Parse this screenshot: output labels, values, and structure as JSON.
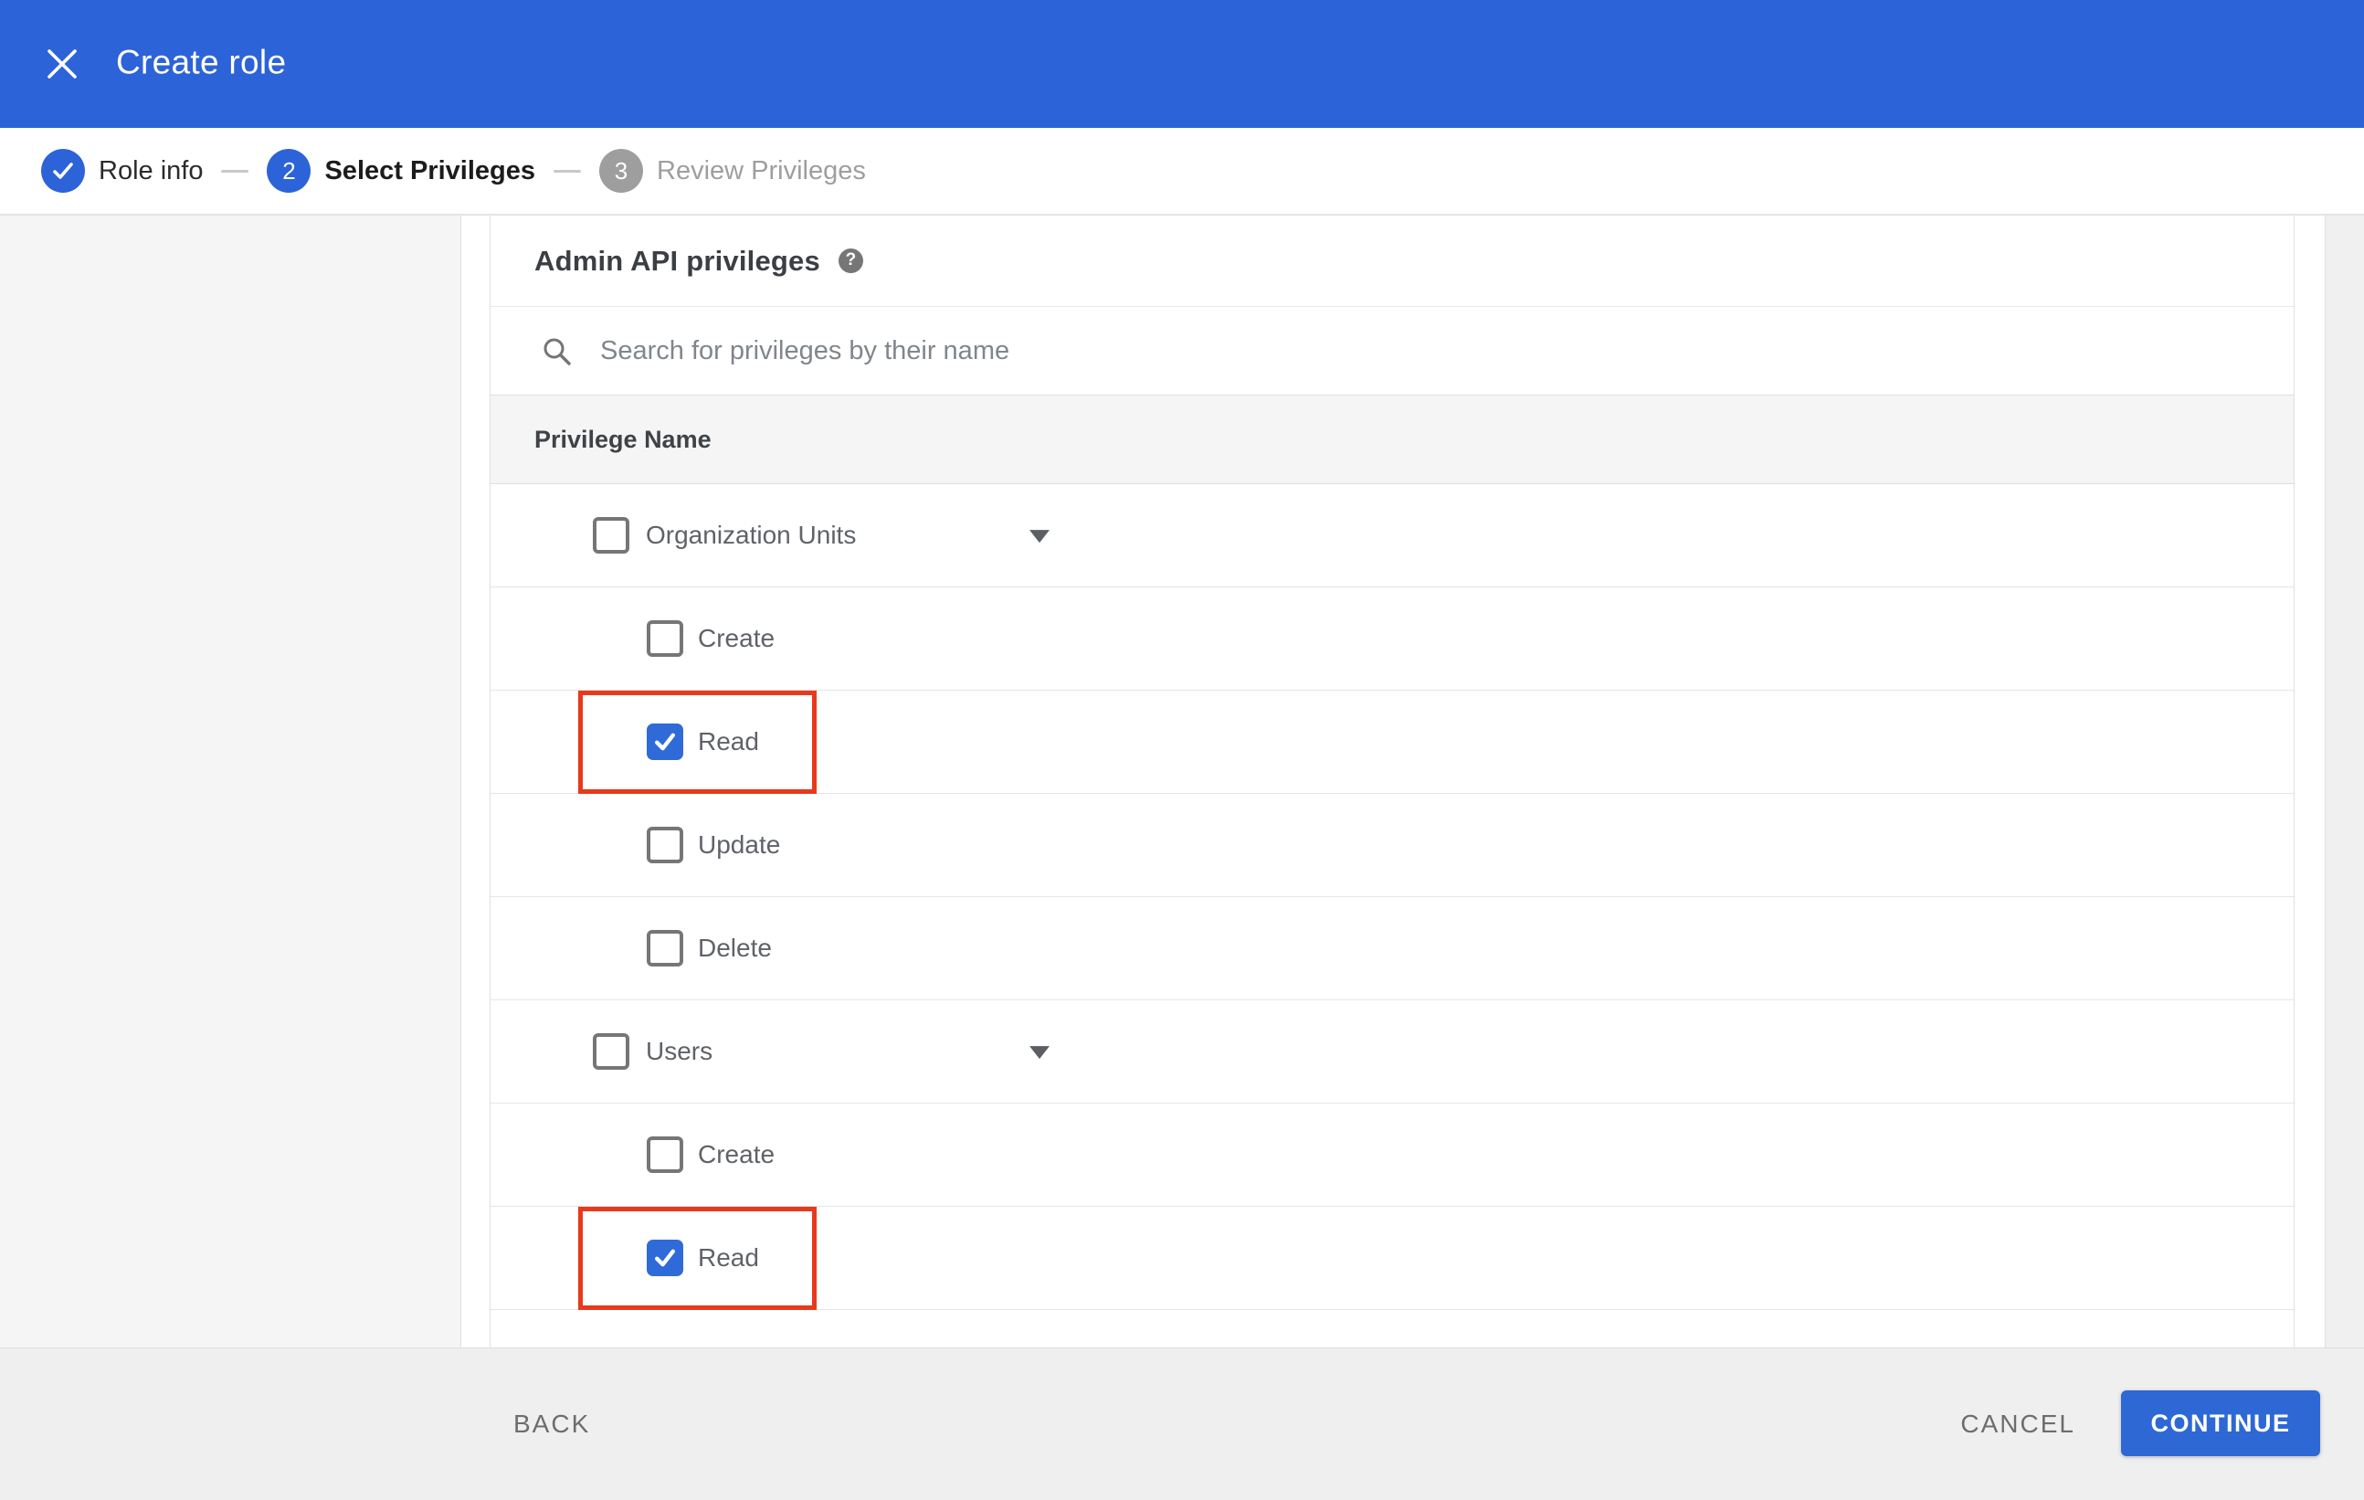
{
  "colors": {
    "app_bar_blue": "#2d63d8",
    "primary_blue": "#2e68d5",
    "checkbox_blue": "#2f6bd8",
    "highlight_red": "#e8391c",
    "step_inactive_gray": "#9e9e9e"
  },
  "icons": {
    "close": "✕",
    "search": "magnifier",
    "help": "?",
    "collapse": "▼",
    "check": "✓"
  },
  "header": {
    "title": "Create role"
  },
  "stepper": {
    "steps": [
      {
        "label": "Role info",
        "indicator": "✓",
        "status": "complete"
      },
      {
        "label": "Select Privileges",
        "indicator": "2",
        "status": "current"
      },
      {
        "label": "Review Privileges",
        "indicator": "3",
        "status": "upcoming"
      }
    ]
  },
  "content": {
    "section_title": "Admin API privileges",
    "help_glyph": "?",
    "search_placeholder": "Search for privileges by their name",
    "table_header": "Privilege Name",
    "rows": [
      {
        "type": "parent",
        "label": "Organization Units",
        "checked": false,
        "highlighted": false
      },
      {
        "type": "child",
        "label": "Create",
        "checked": false,
        "highlighted": false
      },
      {
        "type": "child",
        "label": "Read",
        "checked": true,
        "highlighted": true
      },
      {
        "type": "child",
        "label": "Update",
        "checked": false,
        "highlighted": false
      },
      {
        "type": "child",
        "label": "Delete",
        "checked": false,
        "highlighted": false
      },
      {
        "type": "parent",
        "label": "Users",
        "checked": false,
        "highlighted": false
      },
      {
        "type": "child",
        "label": "Create",
        "checked": false,
        "highlighted": false
      },
      {
        "type": "child",
        "label": "Read",
        "checked": true,
        "highlighted": true
      }
    ]
  },
  "footer": {
    "back_label": "BACK",
    "cancel_label": "CANCEL",
    "continue_label": "CONTINUE"
  }
}
